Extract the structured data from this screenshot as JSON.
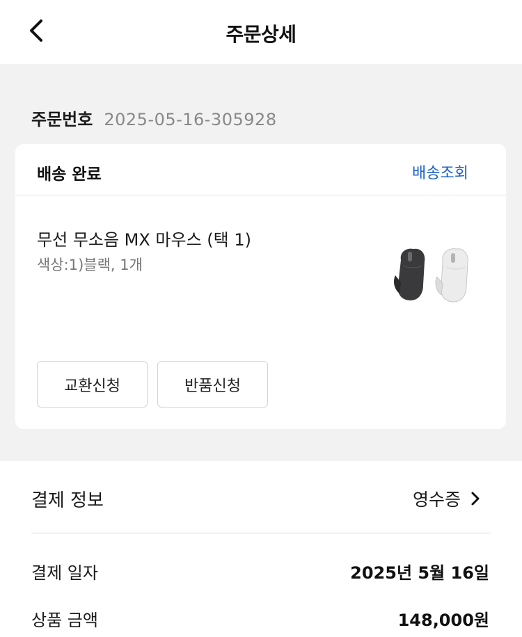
{
  "header": {
    "title": "주문상세"
  },
  "order": {
    "label": "주문번호",
    "number": "2025-05-16-305928"
  },
  "shipment": {
    "status": "배송 완료",
    "track_label": "배송조회",
    "product_name": "무선 무소음 MX 마우스 (택 1)",
    "product_option": "색상:1)블랙, 1개",
    "exchange_label": "교환신청",
    "return_label": "반품신청"
  },
  "payment": {
    "title": "결제 정보",
    "receipt_label": "영수증",
    "rows": [
      {
        "label": "결제 일자",
        "value": "2025년 5월 16일"
      },
      {
        "label": "상품 금액",
        "value": "148,000원"
      }
    ]
  },
  "colors": {
    "link": "#1b63c9",
    "background": "#f2f2f2"
  }
}
